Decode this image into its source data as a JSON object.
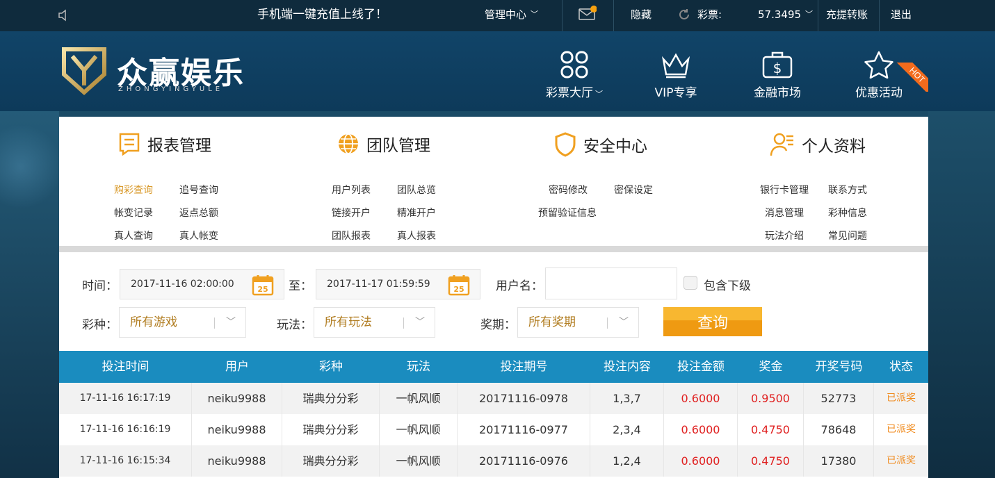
{
  "topbar": {
    "announcement": "手机端一键充值上线了！",
    "management_center": "管理中心",
    "hide": "隐藏",
    "lottery_label": "彩票:",
    "balance": "57.3495",
    "topup": "充提转账",
    "logout": "退出"
  },
  "header": {
    "logo_text": "众赢娱乐",
    "logo_sub": "ZHONGYINGYULE",
    "nav": [
      {
        "label": "彩票大厅",
        "icon": "grid-icon"
      },
      {
        "label": "VIP专享",
        "icon": "crown-icon"
      },
      {
        "label": "金融市场",
        "icon": "briefcase-dollar-icon"
      },
      {
        "label": "优惠活动",
        "icon": "star-icon"
      }
    ],
    "hot_badge": "HOT"
  },
  "categories": [
    {
      "title": "报表管理",
      "links": [
        "购彩查询",
        "追号查询",
        "帐变记录",
        "返点总额",
        "真人查询",
        "真人帐变"
      ]
    },
    {
      "title": "团队管理",
      "links": [
        "用户列表",
        "团队总览",
        "链接开户",
        "精准开户",
        "团队报表",
        "真人报表"
      ]
    },
    {
      "title": "安全中心",
      "links": [
        "密码修改",
        "密保设定",
        "预留验证信息"
      ]
    },
    {
      "title": "个人资料",
      "links": [
        "银行卡管理",
        "联系方式",
        "消息管理",
        "彩种信息",
        "玩法介绍",
        "常见问题"
      ]
    }
  ],
  "filters": {
    "time_label": "时间：",
    "start_time": "2017-11-16 02:00:00",
    "to_label": "至：",
    "end_time": "2017-11-17 01:59:59",
    "calendar_day": "25",
    "username_label": "用户名：",
    "username_value": "",
    "include_sub_label": "包含下级",
    "lottery_label": "彩种：",
    "lottery_value": "所有游戏",
    "play_label": "玩法：",
    "play_value": "所有玩法",
    "period_label": "奖期：",
    "period_value": "所有奖期",
    "query_button": "查询"
  },
  "table": {
    "columns": [
      "投注时间",
      "用户",
      "彩种",
      "玩法",
      "投注期号",
      "投注内容",
      "投注金额",
      "奖金",
      "开奖号码",
      "状态"
    ],
    "rows": [
      {
        "time": "17-11-16 16:17:19",
        "user": "neiku9988",
        "lottery": "瑞典分分彩",
        "play": "一帆风顺",
        "period": "20171116-0978",
        "content": "1,3,7",
        "amount": "0.6000",
        "prize": "0.9500",
        "number": "52773",
        "status": "已派奖"
      },
      {
        "time": "17-11-16 16:16:19",
        "user": "neiku9988",
        "lottery": "瑞典分分彩",
        "play": "一帆风顺",
        "period": "20171116-0977",
        "content": "2,3,4",
        "amount": "0.6000",
        "prize": "0.4750",
        "number": "78648",
        "status": "已派奖"
      },
      {
        "time": "17-11-16 16:15:34",
        "user": "neiku9988",
        "lottery": "瑞典分分彩",
        "play": "一帆风顺",
        "period": "20171116-0976",
        "content": "1,2,4",
        "amount": "0.6000",
        "prize": "0.4750",
        "number": "17380",
        "status": "已派奖"
      }
    ]
  },
  "colors": {
    "accent_orange": "#f0a020",
    "table_header": "#1a8cbf",
    "link_active": "#d99a2b",
    "value_red": "#e02020"
  }
}
